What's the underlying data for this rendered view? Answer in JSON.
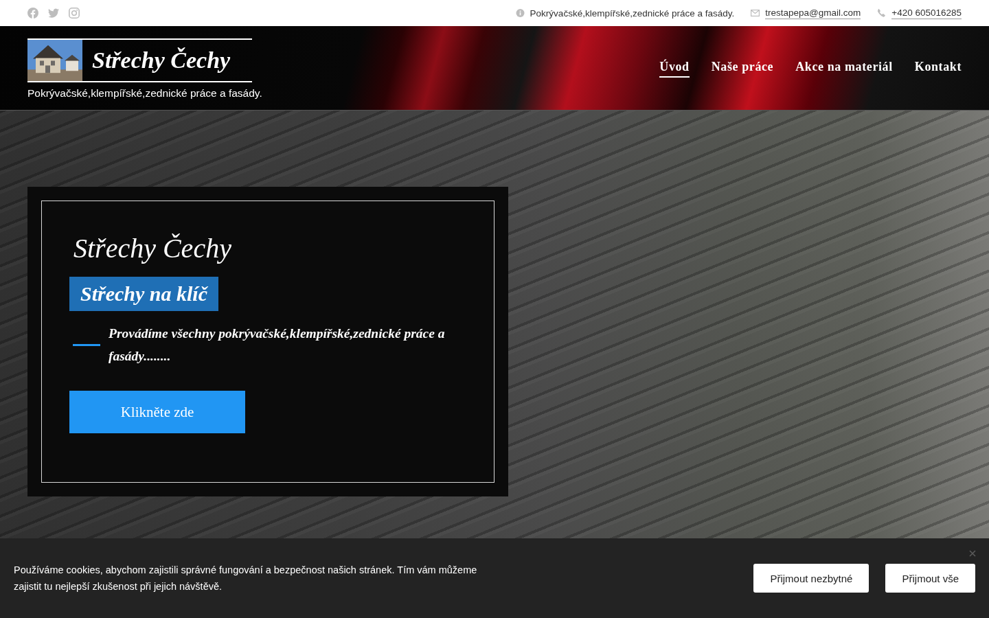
{
  "top_bar": {
    "social_links": [
      {
        "kind": "facebook"
      },
      {
        "kind": "twitter"
      },
      {
        "kind": "instagram"
      }
    ],
    "contacts": [
      {
        "kind": "info",
        "text": "Pokrývačské,klempířské,zednické práce a fasády."
      },
      {
        "kind": "email",
        "text": "trestapepa@gmail.com"
      },
      {
        "kind": "phone",
        "text": "+420 605016285"
      }
    ]
  },
  "header": {
    "logo": {
      "title": "Střechy Čechy",
      "tagline": "Pokrývačské,klempířské,zednické práce a fasády."
    },
    "nav": [
      {
        "label": "Úvod",
        "selected": true
      },
      {
        "label": "Naše práce",
        "selected": false
      },
      {
        "label": "Akce na materiál",
        "selected": false
      },
      {
        "label": "Kontakt",
        "selected": false
      }
    ]
  },
  "hero": {
    "card": {
      "title": "Střechy Čechy",
      "badge": "Střechy na klíč",
      "text": "Provádíme všechny pokrývačské,klempířské,zednické práce a fasády........",
      "button": "Klikněte zde"
    }
  },
  "cookie_bar": {
    "text": "Používáme cookies, abychom zajistili správné fungování a bezpečnost našich stránek. Tím vám můžeme zajistit tu nejlepší zkušenost při jejich návštěvě.",
    "buttons": [
      "Přijmout nezbytné",
      "Přijmout vše"
    ]
  }
}
